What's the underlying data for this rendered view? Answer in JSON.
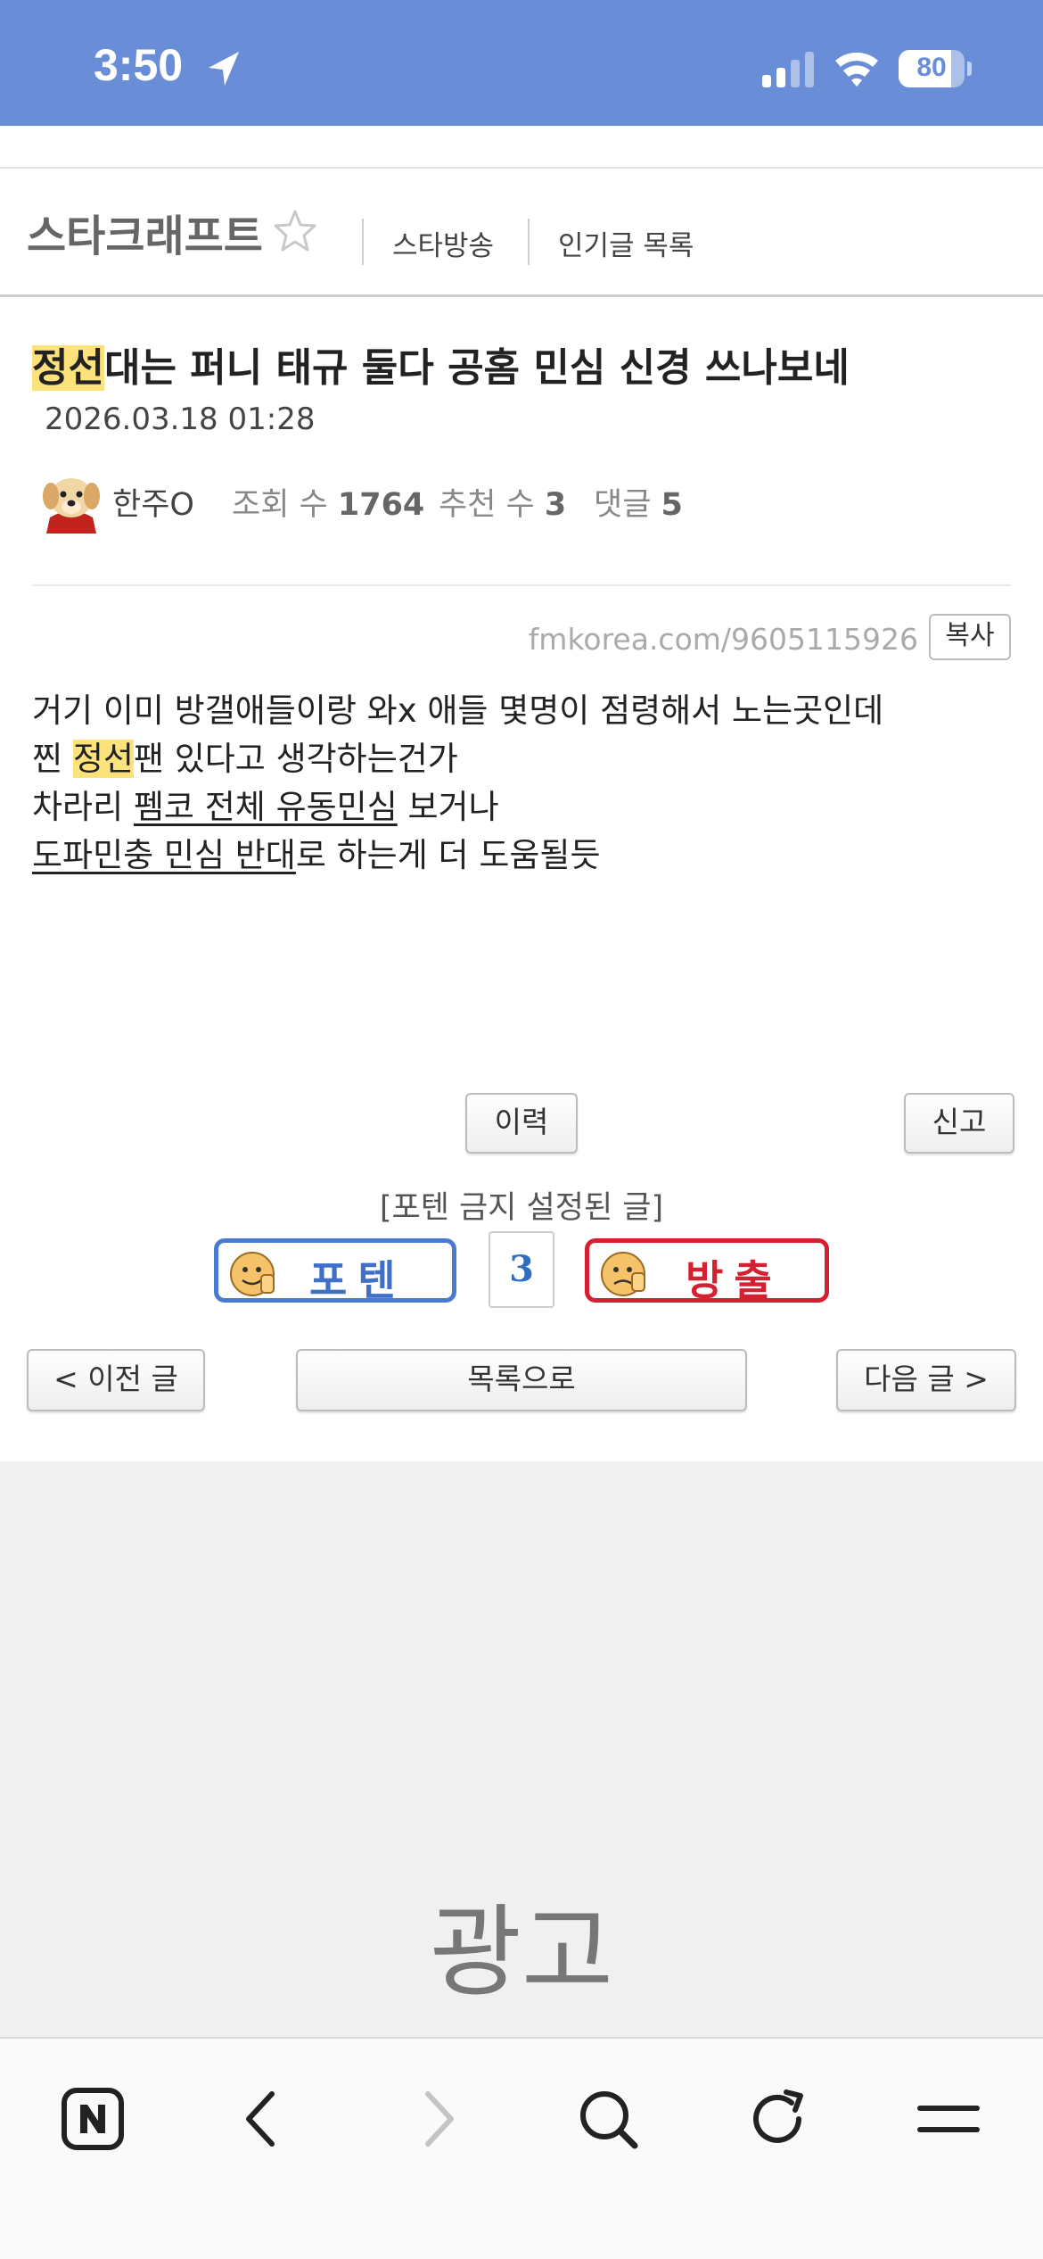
{
  "status_bar": {
    "time": "3:50",
    "battery_text": "80",
    "battery_level": 0.8,
    "accent_color": "#6a8dd8"
  },
  "board_header": {
    "title": "스타크래프트",
    "favorite_icon": "star-outline-icon",
    "links": [
      "스타방송",
      "인기글 목록"
    ]
  },
  "post": {
    "title_highlight": "정선",
    "title_rest": "대는 퍼니 태규 둘다 공홈 민심 신경 쓰나보네",
    "date": "2026.03.18 01:28",
    "author": "한주O",
    "views_label": "조회 수",
    "views": "1764",
    "recommend_label": "추천 수",
    "recommend": "3",
    "comments_label": "댓글",
    "comments": "5",
    "url": "fmkorea.com/9605115926",
    "copy_label": "복사",
    "body": {
      "line1": "거기 이미 방갤애들이랑 와x 애들 몇명이 점령해서 노는곳인데",
      "line2_a": "찐 ",
      "line2_highlight": "정선",
      "line2_b": "팬 있다고 생각하는건가",
      "line3_a": "차라리 ",
      "line3_link": "펨코 전체 유동민심",
      "line3_b": " 보거나",
      "line4_link": "도파민충 민심 반대",
      "line4_b": "로 하는게 더 도움될듯"
    },
    "highlight_color": "#fde17a"
  },
  "actions": {
    "history_label": "이력",
    "report_label": "신고",
    "notice": "[포텐 금지 설정된 글]",
    "upvote_label": "포텐",
    "upvote_color": "#4a7ad0",
    "vote_count": "3",
    "downvote_label": "방출",
    "downvote_color": "#d42030",
    "prev_label": "< 이전 글",
    "list_label": "목록으로",
    "next_label": "다음 글 >"
  },
  "ad": {
    "label": "광고"
  },
  "toolbar": {
    "icons": [
      "naver-home-icon",
      "back-icon",
      "forward-icon",
      "search-icon",
      "refresh-icon",
      "menu-icon"
    ]
  }
}
